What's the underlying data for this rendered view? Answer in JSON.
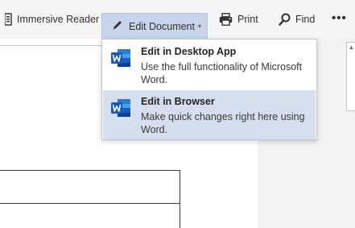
{
  "toolbar": {
    "immersive_reader": "Immersive Reader",
    "edit_document": "Edit Document",
    "edit_caret": "▾",
    "print": "Print",
    "find": "Find",
    "more": "•••"
  },
  "edit_menu": {
    "items": [
      {
        "title": "Edit in Desktop App",
        "description": "Use the full functionality of Microsoft Word.",
        "icon": "word-icon"
      },
      {
        "title": "Edit in Browser",
        "description": "Make quick changes right here using Word.",
        "icon": "word-icon"
      }
    ],
    "highlighted_index": 1
  },
  "colors": {
    "word_blue": "#185abd",
    "word_light": "#41a5ee",
    "active_button": "#c7d4e9",
    "hover_item": "#d6dfef"
  },
  "icons": {
    "immersive_reader": "immersive-reader-icon",
    "edit": "pencil-icon",
    "print": "printer-icon",
    "find": "search-icon",
    "scroll_up": "scroll-up-arrow-icon"
  }
}
